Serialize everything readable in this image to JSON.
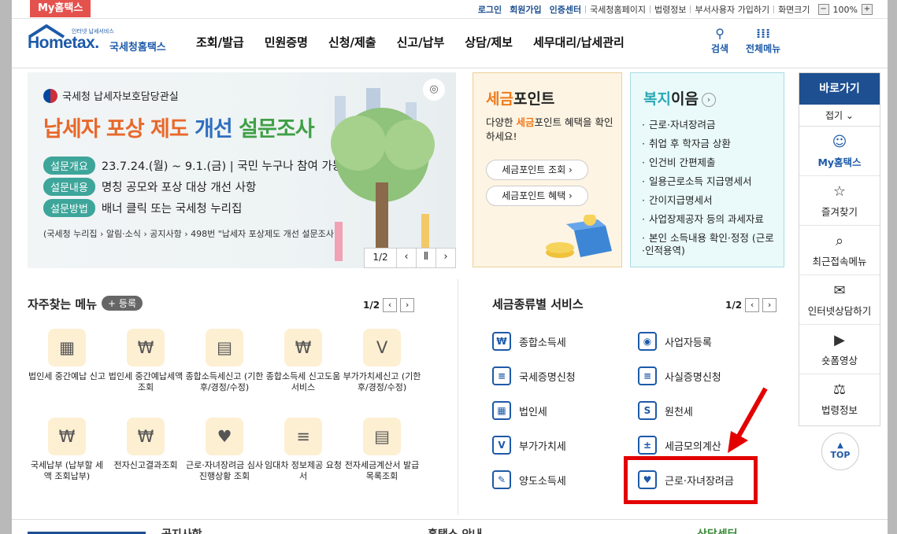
{
  "topbar": {
    "myhome_tag": "My홈택스",
    "links": [
      "로그인",
      "회원가입",
      "인증센터",
      "국세청홈페이지",
      "법령정보",
      "부서사용자 가입하기",
      "화면크기"
    ],
    "zoom_minus": "−",
    "zoom_level": "100%",
    "zoom_plus": "+"
  },
  "header": {
    "logo_text": "Hometax.",
    "logo_sub": "국세청홈택스",
    "logo_tiny": "인터넷 납세서비스",
    "nav": [
      "조회/발급",
      "민원증명",
      "신청/제출",
      "신고/납부",
      "상담/제보",
      "세무대리/납세관리"
    ],
    "search_label": "검색",
    "menu_label": "전체메뉴"
  },
  "banner": {
    "org": "국세청 납세자보호담당관실",
    "title_a": "납세자 포상 제도 ",
    "title_b": "개선",
    "title_c": " 설문조사",
    "rows": [
      {
        "pill": "설문개요",
        "text": "23.7.24.(월) ~ 9.1.(금) | 국민 누구나 참여 가능"
      },
      {
        "pill": "설문내용",
        "text": "명칭 공모와 포상 대상 개선 사항"
      },
      {
        "pill": "설문방법",
        "text": "배너 클릭 또는 국세청 누리집"
      }
    ],
    "note": "(국세청 누리집 › 알림·소식 › 공지사항 › 498번 \"납세자 포상제도 개선 설문조사\")",
    "page": "1/2",
    "prev": "‹",
    "pause": "Ⅱ",
    "next": "›"
  },
  "point_card": {
    "title_a": "세금",
    "title_b": "포인트",
    "desc_a": "다양한 ",
    "desc_b": "세금",
    "desc_c": "포인트 혜택을 확인하세요!",
    "btn1": "세금포인트 조회  ›",
    "btn2": "세금포인트 혜택  ›"
  },
  "welfare_card": {
    "title_a": "복지",
    "title_b": "이음",
    "arrow": "›",
    "items": [
      "근로·자녀장려금",
      "취업 후 학자금 상환",
      "인건비 간편제출",
      "일용근로소득 지급명세서",
      "간이지급명세서",
      "사업장제공자 등의 과세자료",
      "본인 소득내용 확인·정정 (근로·인적용역)"
    ]
  },
  "favorites": {
    "title": "자주찾는 메뉴",
    "add_label": "+ 등록",
    "page": "1/2",
    "prev": "‹",
    "next": "›",
    "items": [
      {
        "label": "법인세 중간예납 신고",
        "icon": "building-icon",
        "glyph": "▦"
      },
      {
        "label": "법인세 중간예납세액 조회",
        "icon": "won-search-icon",
        "glyph": "₩"
      },
      {
        "label": "종합소득세신고 (기한후/경정/수정)",
        "icon": "calendar-icon",
        "glyph": "▤"
      },
      {
        "label": "종합소득세 신고도움 서비스",
        "icon": "won-search-icon",
        "glyph": "₩"
      },
      {
        "label": "부가가치세신고 (기한후/경정/수정)",
        "icon": "vat-icon",
        "glyph": "V"
      },
      {
        "label": "국세납부 (납부할 세액 조회납부)",
        "icon": "money-bag-icon",
        "glyph": "₩"
      },
      {
        "label": "전자신고결과조회",
        "icon": "won-document-icon",
        "glyph": "₩"
      },
      {
        "label": "근로·자녀장려금 심사진행상황 조회",
        "icon": "heart-hand-icon",
        "glyph": "♥"
      },
      {
        "label": "임대차 정보제공 요청서",
        "icon": "certificate-icon",
        "glyph": "≡"
      },
      {
        "label": "전자세금계산서 발급목록조회",
        "icon": "invoice-icon",
        "glyph": "▤"
      }
    ]
  },
  "tax_services": {
    "title": "세금종류별 서비스",
    "page": "1/2",
    "prev": "‹",
    "next": "›",
    "items": [
      {
        "label": "종합소득세",
        "icon": "money-hand-icon",
        "glyph": "₩"
      },
      {
        "label": "사업자등록",
        "icon": "person-icon",
        "glyph": "◉"
      },
      {
        "label": "국세증명신청",
        "icon": "document-icon",
        "glyph": "≡"
      },
      {
        "label": "사실증명신청",
        "icon": "document-icon",
        "glyph": "≡"
      },
      {
        "label": "법인세",
        "icon": "building-icon",
        "glyph": "▦"
      },
      {
        "label": "원천세",
        "icon": "salary-icon",
        "glyph": "S"
      },
      {
        "label": "부가가치세",
        "icon": "vat-icon",
        "glyph": "V"
      },
      {
        "label": "세금모의계산",
        "icon": "calculator-icon",
        "glyph": "±"
      },
      {
        "label": "양도소득세",
        "icon": "document-pen-icon",
        "glyph": "✎"
      },
      {
        "label": "근로·자녀장려금",
        "icon": "heart-hand-icon",
        "glyph": "♥"
      }
    ]
  },
  "quick": {
    "title": "바로가기",
    "fold": "접기 ⌄",
    "items": [
      {
        "label": "My홈택스",
        "icon": "person-icon",
        "glyph": "☺"
      },
      {
        "label": "즐겨찾기",
        "icon": "star-icon",
        "glyph": "☆"
      },
      {
        "label": "최근접속메뉴",
        "icon": "recent-icon",
        "glyph": "⌕"
      },
      {
        "label": "인터넷상담하기",
        "icon": "chat-icon",
        "glyph": "✉"
      },
      {
        "label": "숏폼영상",
        "icon": "play-icon",
        "glyph": "▶"
      },
      {
        "label": "법령정보",
        "icon": "gavel-icon",
        "glyph": "⚖"
      }
    ],
    "top": "TOP"
  },
  "bottom": {
    "a": "공지사항",
    "b": "홈택스 안내",
    "c": "상담센터"
  },
  "colors": {
    "primary": "#1d4f91",
    "highlight_red": "#e30000",
    "point_orange": "#ef7b1c",
    "welfare_teal": "#2aa9b5"
  }
}
